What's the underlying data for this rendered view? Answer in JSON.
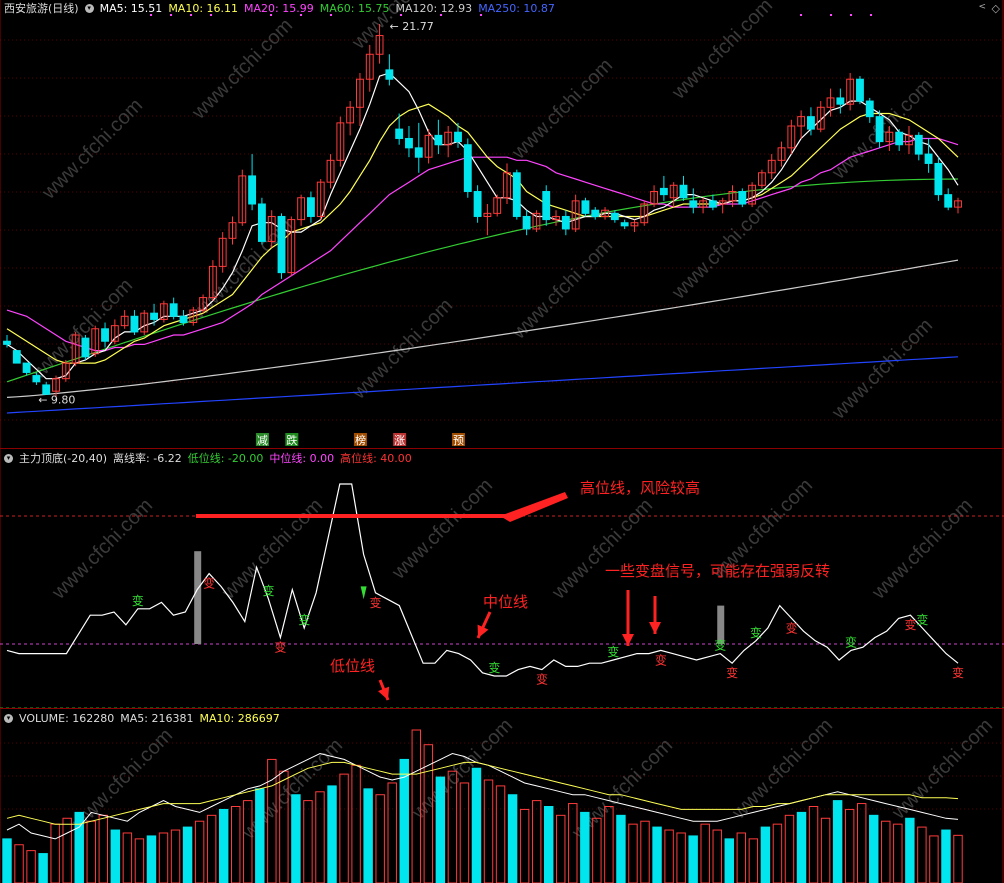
{
  "main_header": {
    "stock": "西安旅游(日线)",
    "ma5": "MA5: 15.51",
    "ma10": "MA10: 16.11",
    "ma20": "MA20: 15.99",
    "ma60": "MA60: 15.75",
    "ma120": "MA120: 12.93",
    "ma250": "MA250: 10.87"
  },
  "price_labels": {
    "high": "21.77",
    "low": "9.80"
  },
  "event_markers": [
    "减",
    "跌",
    "榜",
    "涨",
    "预"
  ],
  "ind_header": {
    "name": "主力顶底(-20,40)",
    "dev": "离线率: -6.22",
    "low": "低位线: -20.00",
    "mid": "中位线: 0.00",
    "high": "高位线: 40.00"
  },
  "annotations": {
    "high_line": "高位线，风险较高",
    "signals": "一些变盘信号，可能存在强弱反转",
    "mid_line": "中位线",
    "low_line": "低位线",
    "signal_char": "变"
  },
  "vol_header": {
    "name": "VOLUME: 162280",
    "ma5": "MA5: 216381",
    "ma10": "MA10: 286697"
  },
  "watermark": "www.cfchi.com",
  "colors": {
    "up": "#ff3b3b",
    "down": "#00e5ee",
    "ma5": "#ffffff",
    "ma10": "#ffff55",
    "ma20": "#ff44ff",
    "ma60": "#33cc33",
    "ma120": "#cccccc",
    "ma250": "#2244ff",
    "annot": "#ff2222"
  },
  "chart_data": [
    {
      "type": "candlestick",
      "title": "西安旅游(日线)",
      "candles": [
        [
          11.6,
          11.8,
          11.4,
          11.5
        ],
        [
          11.3,
          11.2,
          11.0,
          10.9
        ],
        [
          10.9,
          10.8,
          10.5,
          10.6
        ],
        [
          10.5,
          10.6,
          10.2,
          10.3
        ],
        [
          10.2,
          10.3,
          9.9,
          9.9
        ],
        [
          10.0,
          10.5,
          9.8,
          10.4
        ],
        [
          10.4,
          11.0,
          10.3,
          10.9
        ],
        [
          10.9,
          11.9,
          10.8,
          11.8
        ],
        [
          11.7,
          11.8,
          11.0,
          11.1
        ],
        [
          11.2,
          12.1,
          11.1,
          12.0
        ],
        [
          12.0,
          12.2,
          11.4,
          11.6
        ],
        [
          11.6,
          12.3,
          11.5,
          12.1
        ],
        [
          12.1,
          12.6,
          12.0,
          12.4
        ],
        [
          12.4,
          12.6,
          11.8,
          11.9
        ],
        [
          11.9,
          12.6,
          11.8,
          12.5
        ],
        [
          12.5,
          12.8,
          12.1,
          12.3
        ],
        [
          12.3,
          12.9,
          12.2,
          12.8
        ],
        [
          12.8,
          13.0,
          12.3,
          12.4
        ],
        [
          12.4,
          12.6,
          12.1,
          12.2
        ],
        [
          12.2,
          12.7,
          12.1,
          12.6
        ],
        [
          12.6,
          13.1,
          12.5,
          13.0
        ],
        [
          13.0,
          14.2,
          12.9,
          14.0
        ],
        [
          14.0,
          15.1,
          13.8,
          14.9
        ],
        [
          14.9,
          15.6,
          14.7,
          15.4
        ],
        [
          15.4,
          17.1,
          15.3,
          16.9
        ],
        [
          16.9,
          17.6,
          15.8,
          16.0
        ],
        [
          16.0,
          16.2,
          14.7,
          14.8
        ],
        [
          14.8,
          15.8,
          14.6,
          15.6
        ],
        [
          15.6,
          15.7,
          13.6,
          13.8
        ],
        [
          13.8,
          15.6,
          13.7,
          15.5
        ],
        [
          15.5,
          16.3,
          15.3,
          16.2
        ],
        [
          16.2,
          16.4,
          15.4,
          15.6
        ],
        [
          15.6,
          16.8,
          15.5,
          16.7
        ],
        [
          16.7,
          17.6,
          16.5,
          17.4
        ],
        [
          17.4,
          18.8,
          17.2,
          18.6
        ],
        [
          18.6,
          19.3,
          18.2,
          19.1
        ],
        [
          19.1,
          20.2,
          18.5,
          20.0
        ],
        [
          20.0,
          21.1,
          19.6,
          20.8
        ],
        [
          20.8,
          21.77,
          20.5,
          21.4
        ],
        [
          20.3,
          20.8,
          19.8,
          20.0
        ],
        [
          18.4,
          18.9,
          17.9,
          18.1
        ],
        [
          18.1,
          18.5,
          17.5,
          17.8
        ],
        [
          17.8,
          18.6,
          17.0,
          17.5
        ],
        [
          17.5,
          18.4,
          17.3,
          18.2
        ],
        [
          18.2,
          18.7,
          17.6,
          17.9
        ],
        [
          17.9,
          18.5,
          17.5,
          18.3
        ],
        [
          18.3,
          18.6,
          17.8,
          18.0
        ],
        [
          17.9,
          18.1,
          16.2,
          16.4
        ],
        [
          16.4,
          16.6,
          15.4,
          15.6
        ],
        [
          15.6,
          16.0,
          15.0,
          15.7
        ],
        [
          15.7,
          16.3,
          15.6,
          16.2
        ],
        [
          16.2,
          17.3,
          16.0,
          17.0
        ],
        [
          17.0,
          17.1,
          15.5,
          15.6
        ],
        [
          15.6,
          15.8,
          15.0,
          15.2
        ],
        [
          15.2,
          15.8,
          15.1,
          15.7
        ],
        [
          16.4,
          16.6,
          15.3,
          15.5
        ],
        [
          15.5,
          15.8,
          15.3,
          15.6
        ],
        [
          15.6,
          15.8,
          15.0,
          15.2
        ],
        [
          15.2,
          16.3,
          15.1,
          16.1
        ],
        [
          16.1,
          16.2,
          15.6,
          15.7
        ],
        [
          15.8,
          15.9,
          15.5,
          15.6
        ],
        [
          15.6,
          15.9,
          15.5,
          15.8
        ],
        [
          15.7,
          15.8,
          15.4,
          15.5
        ],
        [
          15.4,
          15.5,
          15.2,
          15.3
        ],
        [
          15.3,
          15.5,
          15.1,
          15.4
        ],
        [
          15.4,
          16.1,
          15.3,
          16.0
        ],
        [
          16.0,
          16.6,
          15.9,
          16.4
        ],
        [
          16.5,
          16.9,
          16.1,
          16.3
        ],
        [
          16.2,
          16.7,
          15.9,
          16.6
        ],
        [
          16.6,
          16.9,
          16.1,
          16.2
        ],
        [
          16.1,
          16.5,
          15.7,
          15.9
        ],
        [
          15.9,
          16.2,
          15.7,
          16.1
        ],
        [
          16.1,
          16.3,
          15.8,
          15.9
        ],
        [
          16.0,
          16.2,
          15.7,
          16.1
        ],
        [
          16.1,
          16.6,
          15.9,
          16.4
        ],
        [
          16.4,
          16.5,
          15.9,
          16.0
        ],
        [
          16.0,
          16.7,
          15.9,
          16.6
        ],
        [
          16.6,
          17.1,
          16.5,
          17.0
        ],
        [
          17.0,
          17.6,
          16.8,
          17.4
        ],
        [
          17.4,
          18.0,
          17.2,
          17.8
        ],
        [
          17.8,
          18.7,
          17.6,
          18.5
        ],
        [
          18.5,
          19.0,
          18.1,
          18.8
        ],
        [
          18.8,
          19.1,
          18.2,
          18.4
        ],
        [
          18.4,
          19.3,
          18.3,
          19.1
        ],
        [
          19.1,
          19.7,
          18.8,
          19.4
        ],
        [
          19.4,
          19.7,
          18.9,
          19.2
        ],
        [
          19.2,
          20.2,
          19.0,
          20.0
        ],
        [
          20.0,
          20.1,
          19.2,
          19.3
        ],
        [
          19.3,
          19.4,
          18.6,
          18.8
        ],
        [
          18.8,
          19.0,
          17.8,
          18.0
        ],
        [
          18.0,
          18.5,
          17.7,
          18.3
        ],
        [
          18.3,
          18.4,
          17.7,
          17.9
        ],
        [
          17.9,
          18.5,
          17.6,
          18.2
        ],
        [
          18.2,
          18.3,
          17.4,
          17.6
        ],
        [
          17.6,
          18.1,
          17.0,
          17.3
        ],
        [
          17.3,
          17.5,
          16.1,
          16.3
        ],
        [
          16.3,
          16.5,
          15.8,
          15.9
        ],
        [
          15.9,
          16.2,
          15.7,
          16.1
        ]
      ],
      "ma5": [
        11.5,
        11.3,
        11.0,
        10.7,
        10.4,
        10.4,
        10.5,
        10.9,
        11.0,
        11.2,
        11.3,
        11.7,
        11.9,
        11.9,
        12.1,
        12.2,
        12.4,
        12.4,
        12.4,
        12.5,
        12.6,
        12.9,
        13.3,
        13.8,
        14.5,
        15.3,
        15.4,
        15.4,
        15.2,
        15.1,
        15.1,
        15.3,
        15.5,
        16.3,
        17.0,
        17.7,
        18.4,
        19.2,
        20.1,
        20.2,
        19.9,
        19.6,
        19.0,
        18.3,
        17.9,
        17.9,
        18.0,
        17.7,
        17.2,
        16.7,
        16.2,
        16.2,
        16.1,
        15.8,
        15.6,
        15.6,
        15.5,
        15.4,
        15.5,
        15.6,
        15.6,
        15.7,
        15.7,
        15.6,
        15.5,
        15.6,
        15.8,
        15.9,
        16.1,
        16.3,
        16.3,
        16.2,
        16.1,
        16.0,
        16.1,
        16.1,
        16.2,
        16.4,
        16.7,
        17.1,
        17.6,
        18.1,
        18.4,
        18.7,
        19.0,
        19.1,
        19.3,
        19.3,
        19.1,
        18.9,
        18.7,
        18.3,
        18.2,
        18.0,
        17.9,
        17.5,
        17.1,
        16.6
      ],
      "ma10": [
        12.0,
        11.8,
        11.6,
        11.4,
        11.2,
        11.0,
        10.9,
        10.9,
        10.9,
        10.9,
        11.0,
        11.2,
        11.4,
        11.6,
        11.7,
        11.9,
        12.1,
        12.2,
        12.3,
        12.4,
        12.5,
        12.7,
        12.9,
        13.1,
        13.5,
        13.9,
        14.3,
        14.6,
        14.8,
        15.1,
        15.2,
        15.3,
        15.4,
        15.7,
        16.0,
        16.4,
        16.9,
        17.4,
        18.0,
        18.5,
        18.8,
        19.0,
        19.1,
        19.2,
        19.0,
        18.8,
        18.5,
        18.3,
        17.9,
        17.5,
        17.2,
        17.0,
        16.8,
        16.4,
        16.2,
        16.0,
        15.9,
        15.8,
        15.7,
        15.6,
        15.6,
        15.6,
        15.6,
        15.6,
        15.6,
        15.6,
        15.7,
        15.8,
        15.9,
        16.0,
        16.0,
        16.0,
        16.0,
        16.0,
        16.1,
        16.1,
        16.2,
        16.3,
        16.5,
        16.7,
        16.9,
        17.2,
        17.5,
        17.8,
        18.1,
        18.4,
        18.6,
        18.8,
        18.9,
        18.9,
        18.9,
        18.8,
        18.7,
        18.5,
        18.3,
        18.1,
        17.8,
        17.5
      ],
      "ma20": [
        12.6,
        12.5,
        12.4,
        12.2,
        12.0,
        11.8,
        11.6,
        11.5,
        11.4,
        11.3,
        11.3,
        11.4,
        11.4,
        11.5,
        11.5,
        11.6,
        11.7,
        11.8,
        11.8,
        11.9,
        12.0,
        12.1,
        12.2,
        12.4,
        12.6,
        12.8,
        13.1,
        13.3,
        13.5,
        13.7,
        13.9,
        14.1,
        14.3,
        14.5,
        14.8,
        15.1,
        15.4,
        15.7,
        16.0,
        16.3,
        16.5,
        16.7,
        16.9,
        17.1,
        17.2,
        17.3,
        17.4,
        17.5,
        17.5,
        17.5,
        17.5,
        17.5,
        17.4,
        17.4,
        17.3,
        17.2,
        17.0,
        16.9,
        16.8,
        16.7,
        16.6,
        16.5,
        16.4,
        16.3,
        16.2,
        16.1,
        16.0,
        16.0,
        15.9,
        15.9,
        15.9,
        15.9,
        15.9,
        16.0,
        16.0,
        16.0,
        16.1,
        16.2,
        16.3,
        16.4,
        16.5,
        16.7,
        16.8,
        17.0,
        17.1,
        17.3,
        17.5,
        17.6,
        17.7,
        17.8,
        17.9,
        18.0,
        18.0,
        18.1,
        18.1,
        18.1,
        18.0,
        17.9
      ],
      "ma60_range": [
        10.3,
        16.8
      ],
      "ma120_range": [
        9.8,
        14.2
      ],
      "ma250_range": [
        9.3,
        11.1
      ],
      "labels": {
        "high": "21.77",
        "low": "9.80"
      }
    },
    {
      "type": "line",
      "title": "主力顶底(-20,40)",
      "ylim": [
        -30,
        60
      ],
      "reference_lines": {
        "high": 40,
        "mid": 0,
        "low": -20
      },
      "values": [
        -2,
        -3,
        -3,
        -3,
        -3,
        -3,
        3,
        9,
        9,
        10,
        6,
        11,
        11,
        13,
        9,
        10,
        17,
        22,
        18,
        13,
        7,
        24,
        14,
        2,
        17,
        5,
        16,
        33,
        50,
        50,
        28,
        16,
        14,
        12,
        3,
        -6,
        -6,
        -2,
        -3,
        -5,
        -9,
        -10,
        -10,
        -8,
        -7,
        -8,
        -5,
        -7,
        -7,
        -6,
        -6,
        -5,
        -4,
        -3,
        -3,
        -2,
        -3,
        -4,
        -5,
        -4,
        -3,
        -6,
        -2,
        1,
        5,
        12,
        8,
        4,
        1,
        -1,
        -5,
        -2,
        -1,
        2,
        4,
        8,
        9,
        5,
        1,
        -3,
        -6
      ],
      "signals": [
        11,
        17,
        22,
        23,
        25,
        31,
        41,
        45,
        51,
        55,
        60,
        61,
        63,
        66,
        71,
        76,
        77,
        80
      ],
      "bars": [
        [
          16,
          0,
          29
        ],
        [
          60,
          0,
          12
        ]
      ]
    },
    {
      "type": "bar",
      "title": "VOLUME: 162280",
      "series": [
        {
          "name": "MA5: 216381",
          "values": [
            180,
            200,
            170,
            160,
            150,
            170,
            190,
            240,
            230,
            220,
            210,
            240,
            260,
            280,
            260,
            250,
            240,
            260,
            280,
            300,
            320,
            330,
            350,
            380,
            400,
            420,
            440,
            430,
            420,
            400,
            380,
            360,
            350,
            360,
            380,
            400,
            420,
            440,
            430,
            410,
            400,
            380,
            360,
            340,
            330,
            320,
            310,
            300,
            300,
            290,
            280,
            270,
            260,
            250,
            240,
            230,
            220,
            210,
            210,
            210,
            220,
            230,
            240,
            250,
            260,
            270,
            280,
            290,
            300,
            310,
            300,
            290,
            280,
            270,
            260,
            250,
            240,
            230,
            220,
            216
          ]
        },
        {
          "name": "MA10: 286697",
          "values": [
            220,
            230,
            220,
            210,
            200,
            200,
            200,
            210,
            220,
            230,
            240,
            250,
            260,
            270,
            270,
            270,
            270,
            280,
            290,
            300,
            310,
            320,
            330,
            350,
            370,
            390,
            400,
            410,
            410,
            400,
            390,
            380,
            370,
            370,
            370,
            380,
            390,
            400,
            410,
            410,
            400,
            390,
            380,
            370,
            360,
            350,
            340,
            330,
            320,
            310,
            300,
            300,
            290,
            280,
            270,
            260,
            250,
            250,
            250,
            250,
            250,
            250,
            260,
            260,
            270,
            270,
            280,
            290,
            300,
            300,
            300,
            300,
            300,
            300,
            300,
            300,
            290,
            290,
            290,
            287
          ]
        }
      ],
      "values": [
        150,
        130,
        110,
        100,
        200,
        220,
        240,
        210,
        230,
        180,
        170,
        150,
        160,
        170,
        180,
        190,
        210,
        230,
        250,
        260,
        280,
        320,
        420,
        380,
        300,
        280,
        310,
        330,
        370,
        400,
        320,
        300,
        340,
        420,
        520,
        470,
        360,
        380,
        340,
        390,
        350,
        330,
        300,
        250,
        280,
        260,
        230,
        270,
        240,
        220,
        260,
        230,
        200,
        210,
        190,
        180,
        170,
        160,
        200,
        180,
        150,
        170,
        150,
        190,
        200,
        230,
        240,
        260,
        220,
        280,
        250,
        270,
        230,
        210,
        200,
        220,
        190,
        160,
        180,
        162
      ]
    }
  ]
}
